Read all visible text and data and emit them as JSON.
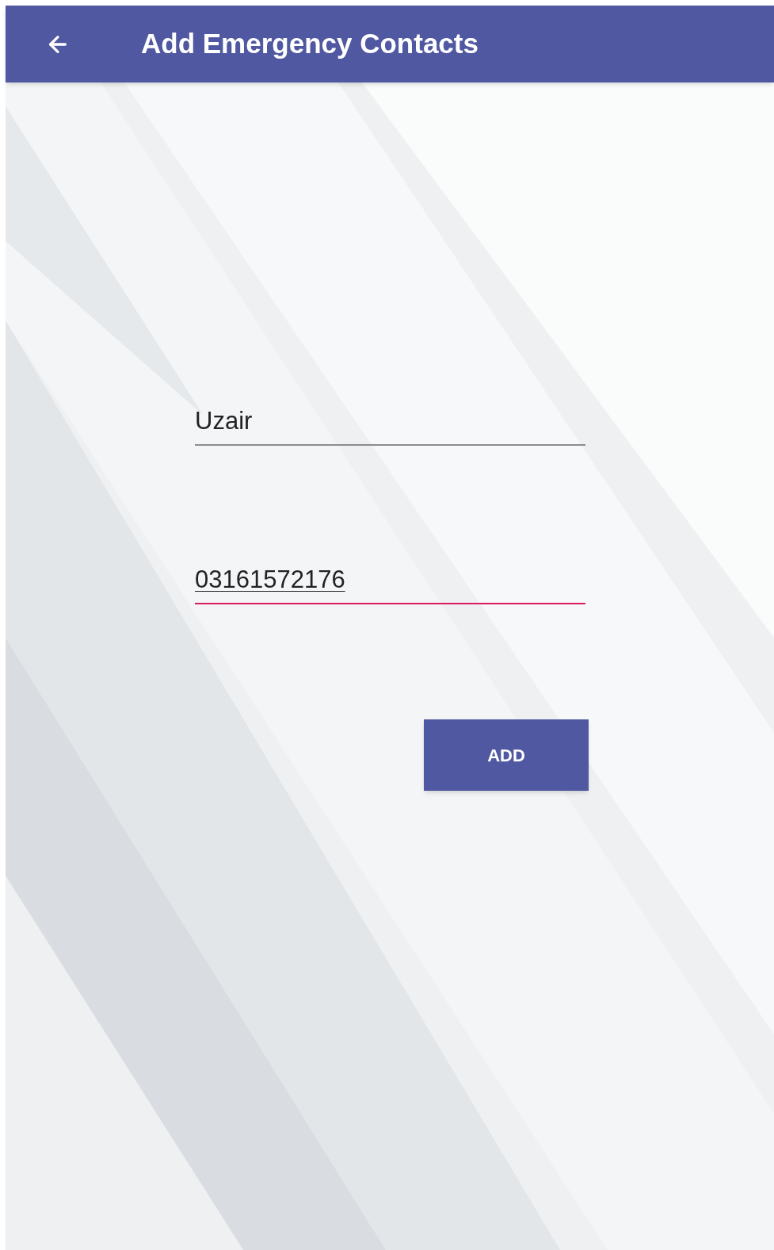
{
  "app_bar": {
    "title": "Add Emergency Contacts"
  },
  "fields": [
    {
      "value": "Uzair",
      "focused": false
    },
    {
      "value": "03161572176",
      "focused": true
    }
  ],
  "add_button": {
    "label": "ADD"
  }
}
